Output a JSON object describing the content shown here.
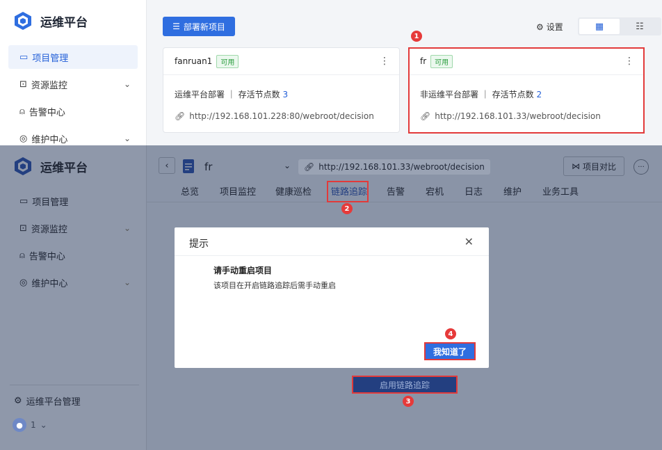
{
  "app": {
    "title": "运维平台"
  },
  "nav": {
    "items": [
      {
        "label": "项目管理"
      },
      {
        "label": "资源监控"
      },
      {
        "label": "告警中心"
      },
      {
        "label": "维护中心"
      }
    ],
    "bottom_label": "运维平台管理",
    "user": "1"
  },
  "toolbar": {
    "deploy_label": "部署新项目",
    "settings_label": "设置"
  },
  "cards": [
    {
      "name": "fanruan1",
      "badge": "可用",
      "type": "运维平台部署",
      "nodes_label": "存活节点数",
      "nodes": "3",
      "url": "http://192.168.101.228:80/webroot/decision"
    },
    {
      "name": "fr",
      "badge": "可用",
      "type": "非运维平台部署",
      "nodes_label": "存活节点数",
      "nodes": "2",
      "url": "http://192.168.101.33/webroot/decision"
    }
  ],
  "project": {
    "name": "fr",
    "url": "http://192.168.101.33/webroot/decision",
    "compare_label": "项目对比",
    "tabs": [
      {
        "label": "总览"
      },
      {
        "label": "项目监控"
      },
      {
        "label": "健康巡检"
      },
      {
        "label": "链路追踪"
      },
      {
        "label": "告警"
      },
      {
        "label": "宕机"
      },
      {
        "label": "日志"
      },
      {
        "label": "维护"
      },
      {
        "label": "业务工具"
      }
    ],
    "enable_label": "启用链路追踪"
  },
  "dialog": {
    "title": "提示",
    "heading": "请手动重启项目",
    "body": "该项目在开启链路追踪后需手动重启",
    "ok_label": "我知道了"
  },
  "markers": [
    "1",
    "2",
    "3",
    "4"
  ],
  "colors": {
    "accent": "#2f6ee0",
    "highlight": "#e23a3a",
    "available": "#2a9d3d"
  }
}
